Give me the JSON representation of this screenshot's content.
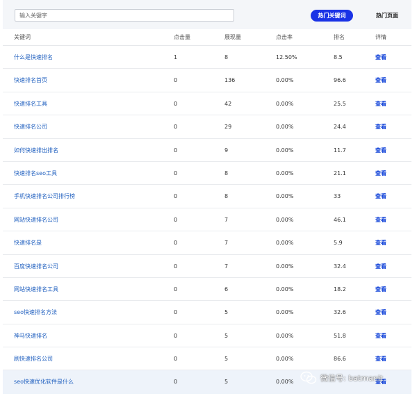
{
  "search": {
    "placeholder": "输入关键字"
  },
  "tabs": [
    {
      "label": "热门关键词",
      "active": true
    },
    {
      "label": "热门页面",
      "active": false
    }
  ],
  "table": {
    "headers": [
      "关键词",
      "点击量",
      "展现量",
      "点击率",
      "排名",
      "详情"
    ],
    "rows": [
      {
        "keyword": "什么是快速排名",
        "clicks": "1",
        "impressions": "8",
        "ctr": "12.50%",
        "rank": "8.5",
        "detail": "查看"
      },
      {
        "keyword": "快速排名首页",
        "clicks": "0",
        "impressions": "136",
        "ctr": "0.00%",
        "rank": "96.6",
        "detail": "查看"
      },
      {
        "keyword": "快速排名工具",
        "clicks": "0",
        "impressions": "42",
        "ctr": "0.00%",
        "rank": "25.5",
        "detail": "查看"
      },
      {
        "keyword": "快速排名公司",
        "clicks": "0",
        "impressions": "29",
        "ctr": "0.00%",
        "rank": "24.4",
        "detail": "查看"
      },
      {
        "keyword": "如何快速排出排名",
        "clicks": "0",
        "impressions": "9",
        "ctr": "0.00%",
        "rank": "11.7",
        "detail": "查看"
      },
      {
        "keyword": "快速排名seo工具",
        "clicks": "0",
        "impressions": "8",
        "ctr": "0.00%",
        "rank": "21.1",
        "detail": "查看"
      },
      {
        "keyword": "手机快速排名公司排行榜",
        "clicks": "0",
        "impressions": "8",
        "ctr": "0.00%",
        "rank": "33",
        "detail": "查看"
      },
      {
        "keyword": "网站快速排名公司",
        "clicks": "0",
        "impressions": "7",
        "ctr": "0.00%",
        "rank": "46.1",
        "detail": "查看"
      },
      {
        "keyword": "快速排名是",
        "clicks": "0",
        "impressions": "7",
        "ctr": "0.00%",
        "rank": "5.9",
        "detail": "查看"
      },
      {
        "keyword": "百度快速排名公司",
        "clicks": "0",
        "impressions": "7",
        "ctr": "0.00%",
        "rank": "32.4",
        "detail": "查看"
      },
      {
        "keyword": "网站快速排名工具",
        "clicks": "0",
        "impressions": "6",
        "ctr": "0.00%",
        "rank": "18.2",
        "detail": "查看"
      },
      {
        "keyword": "seo快速排名方法",
        "clicks": "0",
        "impressions": "5",
        "ctr": "0.00%",
        "rank": "32.6",
        "detail": "查看"
      },
      {
        "keyword": "神马快速排名",
        "clicks": "0",
        "impressions": "5",
        "ctr": "0.00%",
        "rank": "51.8",
        "detail": "查看"
      },
      {
        "keyword": "刷快速排名公司",
        "clicks": "0",
        "impressions": "5",
        "ctr": "0.00%",
        "rank": "86.6",
        "detail": "查看"
      },
      {
        "keyword": "seo快速优化软件是什么",
        "clicks": "0",
        "impressions": "5",
        "ctr": "0.00%",
        "rank": "",
        "detail": "查看"
      }
    ]
  },
  "watermark": {
    "text": "微信号: batmanit",
    "icon": "wechat-icon"
  },
  "colors": {
    "accent": "#1a33e6",
    "link": "#1f5fbf",
    "detail": "#1344d9",
    "toolbar_bg": "#f4f6f9"
  }
}
